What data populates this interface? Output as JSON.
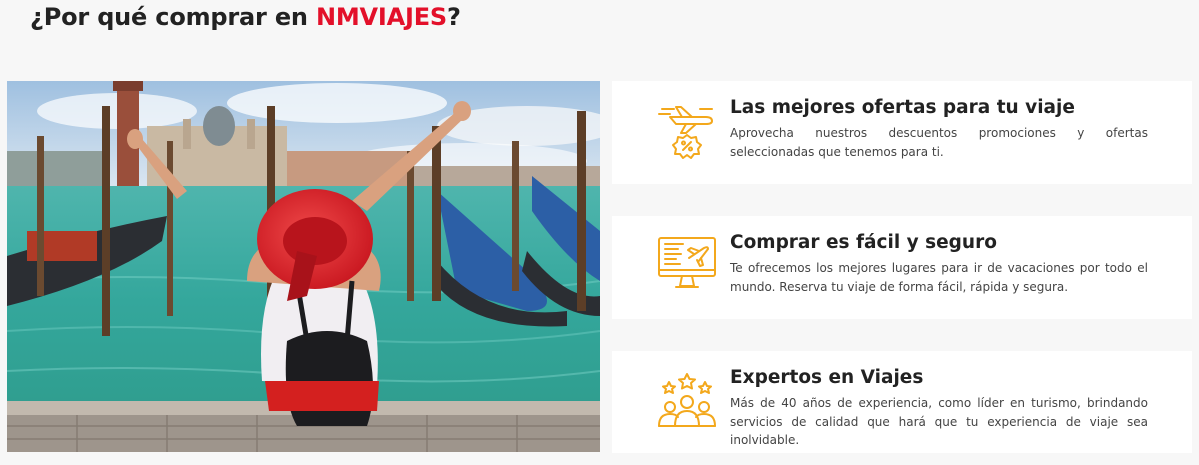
{
  "heading": {
    "prefix": "¿Por qué comprar en ",
    "brand": "NMVIAJES",
    "suffix": "?",
    "brand_color": "#e3102a"
  },
  "accent_color": "#f3a81c",
  "features": [
    {
      "icon": "airplane-discount-icon",
      "title": "Las mejores ofertas para tu viaje",
      "text": "Aprovecha nuestros descuentos promociones y ofertas seleccionadas que tenemos para ti."
    },
    {
      "icon": "monitor-airplane-icon",
      "title": "Comprar es fácil y seguro",
      "text": "Te ofrecemos los mejores lugares para ir de vacaciones por todo el mundo. Reserva tu viaje de forma fácil, rápida y segura."
    },
    {
      "icon": "experts-stars-icon",
      "title": "Expertos en Viajes",
      "text": "Más de 40 años de experiencia, como líder en turismo, brindando servicios de calidad que hará que tu experiencia de viaje sea inolvidable."
    }
  ]
}
